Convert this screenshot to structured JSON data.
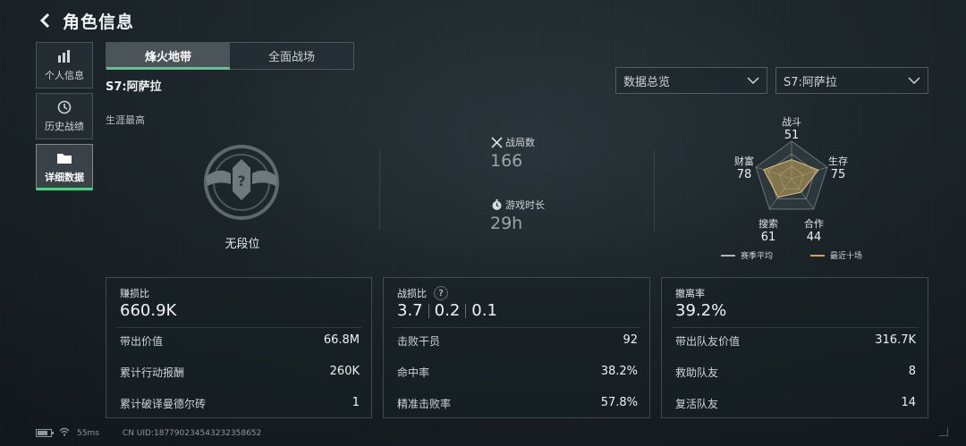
{
  "header": {
    "title": "角色信息"
  },
  "sidebar": {
    "items": [
      {
        "label": "个人信息",
        "icon": "bar-chart-icon",
        "active": false
      },
      {
        "label": "历史战绩",
        "icon": "clock-icon",
        "active": false
      },
      {
        "label": "详细数据",
        "icon": "folder-icon",
        "active": true
      }
    ]
  },
  "tabs": [
    {
      "label": "烽火地带",
      "active": true
    },
    {
      "label": "全面战场",
      "active": false
    }
  ],
  "season_title": "S7:阿萨拉",
  "filters": {
    "view": "数据总览",
    "season": "S7:阿萨拉"
  },
  "career": {
    "label": "生涯最高",
    "rank": "无段位"
  },
  "stats": {
    "matches_label": "战局数",
    "matches_value": "166",
    "playtime_label": "游戏时长",
    "playtime_value": "29h"
  },
  "radar": {
    "axes": [
      {
        "label": "战斗",
        "value": "51"
      },
      {
        "label": "生存",
        "value": "75"
      },
      {
        "label": "合作",
        "value": "44"
      },
      {
        "label": "搜索",
        "value": "61"
      },
      {
        "label": "财富",
        "value": "78"
      }
    ],
    "recent_values": [
      51,
      75,
      44,
      61,
      78
    ],
    "legend_season_avg": "赛季平均",
    "legend_recent": "最近十场",
    "colors": {
      "season_avg": "#aeb7bb",
      "recent": "#c9a85a"
    }
  },
  "panels": {
    "profit": {
      "title": "赚损比",
      "value": "660.9K",
      "rows": [
        {
          "label": "带出价值",
          "value": "66.8M"
        },
        {
          "label": "累计行动报酬",
          "value": "260K"
        },
        {
          "label": "累计破译曼德尔砖",
          "value": "1"
        }
      ]
    },
    "kd": {
      "title": "战损比",
      "help": "?",
      "values": [
        "3.7",
        "0.2",
        "0.1"
      ],
      "rows": [
        {
          "label": "击败干员",
          "value": "92"
        },
        {
          "label": "命中率",
          "value": "38.2%"
        },
        {
          "label": "精准击败率",
          "value": "57.8%"
        }
      ]
    },
    "extract": {
      "title": "撤离率",
      "value": "39.2%",
      "rows": [
        {
          "label": "带出队友价值",
          "value": "316.7K"
        },
        {
          "label": "救助队友",
          "value": "8"
        },
        {
          "label": "复活队友",
          "value": "14"
        }
      ]
    }
  },
  "footer": {
    "ping": "55ms",
    "uid": "CN UID:18779023454323235865​2"
  },
  "colors": {
    "accent": "#4fd08a",
    "gold": "#c9a85a"
  }
}
